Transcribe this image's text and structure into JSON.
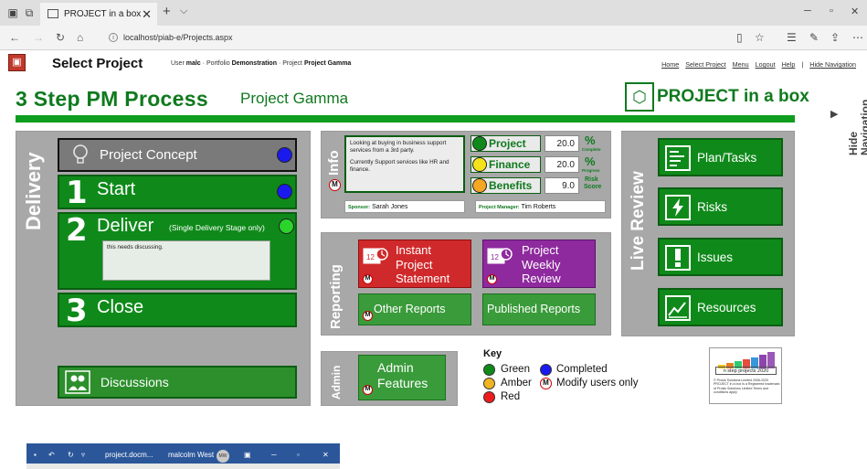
{
  "browser": {
    "tab_title": "PROJECT in a box",
    "url": "localhost/piab-e/Projects.aspx"
  },
  "header": {
    "page_title": "Select Project",
    "user_label": "User",
    "user_name": "malc",
    "portfolio_label": "Portfolio",
    "portfolio_name": "Demonstration",
    "project_label": "Project",
    "project_name": "Project Gamma",
    "links": [
      "Home",
      "Select Project",
      "Menu",
      "Logout",
      "Help"
    ],
    "hide_navigation_link": "Hide Navigation"
  },
  "main": {
    "process_title": "3 Step PM Process",
    "project_title": "Project Gamma",
    "brand": "PROJECT in a box",
    "hide_nav_line1": "Hide",
    "hide_nav_line2": "Navigation"
  },
  "delivery": {
    "label": "Delivery",
    "concept": "Project Concept",
    "steps": [
      {
        "num": "1",
        "label": "Start"
      },
      {
        "num": "2",
        "label": "Deliver",
        "sub": "(Single Delivery Stage only)",
        "note": "this needs discussing."
      },
      {
        "num": "3",
        "label": "Close"
      }
    ],
    "discussions": "Discussions"
  },
  "info": {
    "label": "Info",
    "summary_line1": "Looking at buying in business support services from a 3rd party.",
    "summary_line2": "Currently Support services like HR and finance.",
    "rows": [
      {
        "label": "Project",
        "value": "20.0",
        "unit": "%",
        "unit_sub": "Complete"
      },
      {
        "label": "Finance",
        "value": "20.0",
        "unit": "%",
        "unit_sub": "Progress"
      },
      {
        "label": "Benefits",
        "value": "9.0",
        "unit": "Risk",
        "unit_sub": "Score"
      }
    ],
    "sponsor_label": "Sponsor:",
    "sponsor": "Sarah Jones",
    "pm_label": "Project Manager:",
    "pm": "Tim Roberts",
    "m": "M"
  },
  "reporting": {
    "label": "Reporting",
    "instant": [
      "Instant",
      "Project",
      "Statement"
    ],
    "weekly": [
      "Project",
      "Weekly",
      "Review"
    ],
    "other": "Other Reports",
    "published": "Published Reports"
  },
  "admin": {
    "label": "Admin",
    "features_line1": "Admin",
    "features_line2": "Features"
  },
  "live_review": {
    "label": "Live Review",
    "items": [
      "Plan/Tasks",
      "Risks",
      "Issues",
      "Resources"
    ]
  },
  "key": {
    "title": "Key",
    "green": "Green",
    "completed": "Completed",
    "amber": "Amber",
    "modify": "Modify users only",
    "red": "Red"
  },
  "logo_card": {
    "tag": "n step projects 2020",
    "fine": "© Prosis Solutions Limited 2006-2020 PROJECT in a box is a Registered trademark of Prosis Solutions Limited Terms and conditions apply"
  },
  "taskbar": {
    "doc": "project.docm...",
    "user": "malcolm West",
    "initials": "MW"
  },
  "colors": {
    "brand_green": "#0f7a1e",
    "button_green": "#0f8a1a",
    "panel_gray": "#a8a8a8",
    "report_red": "#d0292b",
    "report_purple": "#8e2a9e"
  }
}
